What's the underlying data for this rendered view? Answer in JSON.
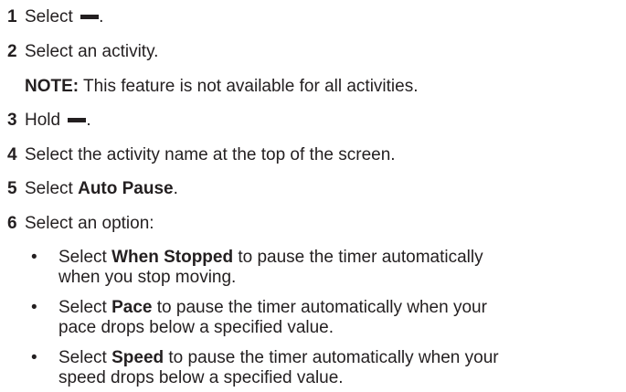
{
  "steps": [
    {
      "num": "1",
      "pre": "Select ",
      "icon": "menu-icon",
      "post": "."
    },
    {
      "num": "2",
      "text": "Select an activity."
    },
    {
      "num": "3",
      "pre": "Hold ",
      "icon": "menu-icon",
      "post": "."
    },
    {
      "num": "4",
      "text": "Select the activity name at the top of the screen."
    },
    {
      "num": "5",
      "pre": "Select ",
      "bold": "Auto Pause",
      "post": "."
    },
    {
      "num": "6",
      "text": "Select an option:"
    }
  ],
  "note": {
    "label": "NOTE:",
    "text": " This feature is not available for all activities."
  },
  "bullet_char": "•",
  "options": [
    {
      "pre": "Select ",
      "bold": "When Stopped",
      "line1": " to pause the timer automatically",
      "line2": "when you stop moving."
    },
    {
      "pre": "Select ",
      "bold": "Pace",
      "line1": " to pause the timer automatically when your",
      "line2": "pace drops below a specified value."
    },
    {
      "pre": "Select ",
      "bold": "Speed",
      "line1": " to pause the timer automatically when your",
      "line2": "speed drops below a specified value."
    }
  ]
}
